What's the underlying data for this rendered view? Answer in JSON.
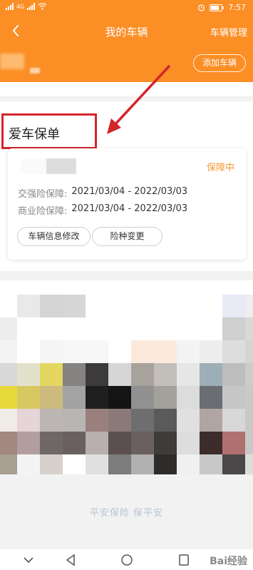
{
  "status_bar": {
    "time": "7:57",
    "network": "4G",
    "battery_level": 0.8
  },
  "header": {
    "title": "我的车辆",
    "manage_label": "车辆管理"
  },
  "banner": {
    "add_car_label": "添加车辆"
  },
  "policy_section": {
    "title": "爱车保单",
    "card": {
      "status": "保障中",
      "rows": [
        {
          "label": "交强险保障:",
          "dates": "2021/03/04 - 2022/03/03"
        },
        {
          "label": "商业险保障:",
          "dates": "2021/03/04 - 2022/03/03"
        }
      ],
      "buttons": {
        "edit_label": "车辆信息修改",
        "change_label": "险种变更"
      }
    }
  },
  "bottom_slogan": "平安保险 保平安",
  "watermark": "Bai经验",
  "colors": {
    "accent": "#fb8e25",
    "status": "#f39a2f",
    "annotation": "#d3262a"
  }
}
